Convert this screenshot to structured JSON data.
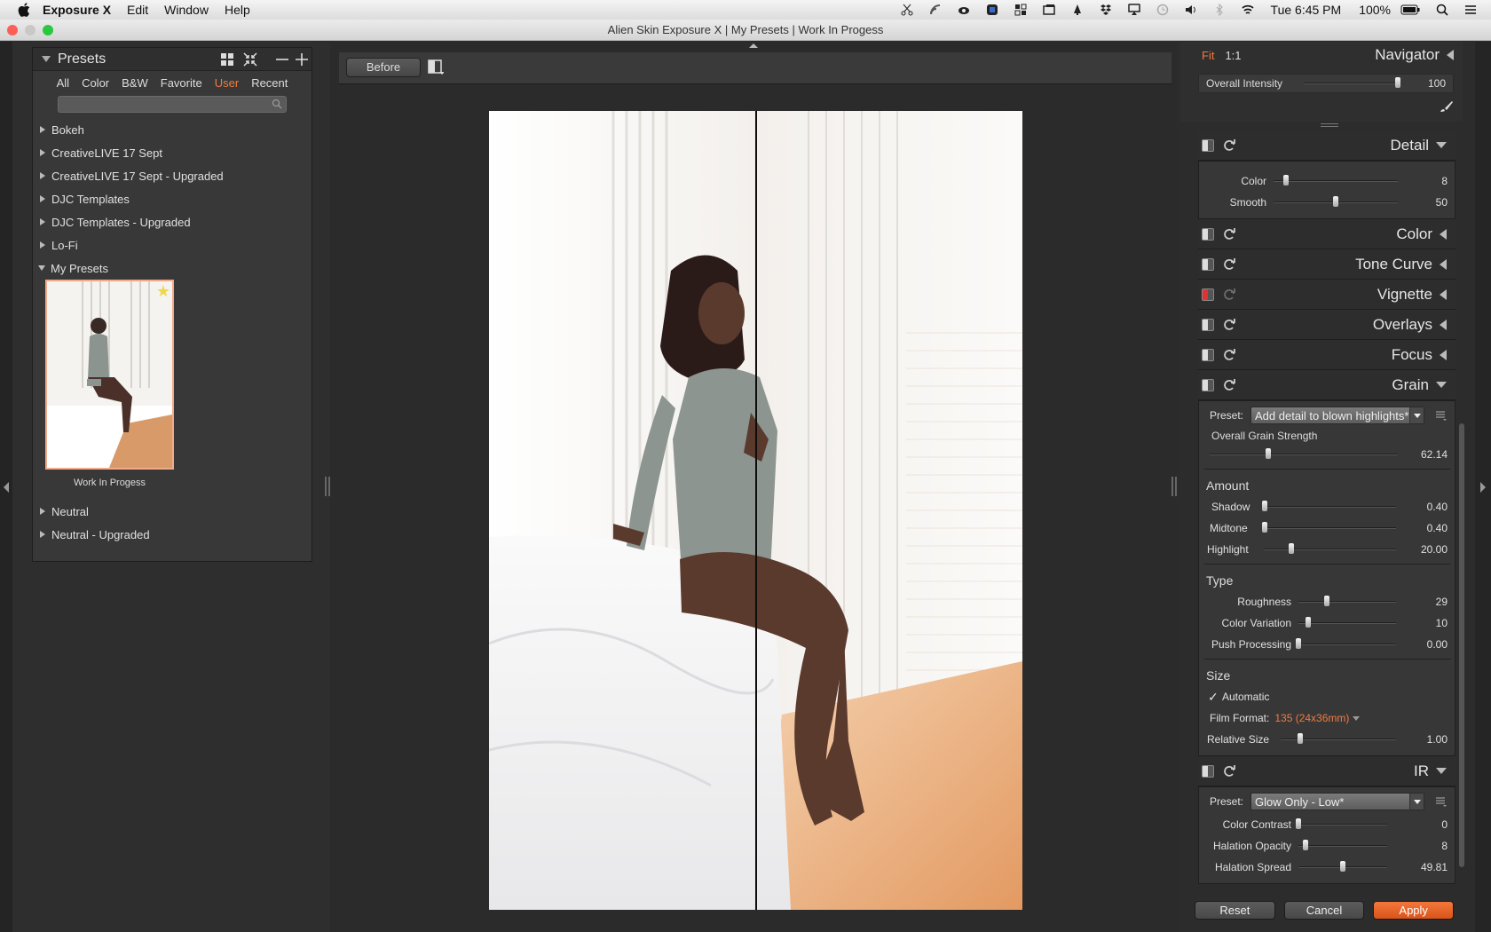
{
  "menubar": {
    "app_name": "Exposure X",
    "menus": [
      "Edit",
      "Window",
      "Help"
    ],
    "clock": "Tue 6:45 PM",
    "battery": "100%",
    "icons": [
      "scissors-icon",
      "feed-icon",
      "creative-cloud-icon",
      "badge-icon",
      "grid-icon",
      "stack-icon",
      "bell-icon",
      "dropbox-icon",
      "airplay-icon",
      "timemachine-icon",
      "volume-icon",
      "bluetooth-icon",
      "wifi-icon",
      "battery-icon",
      "search-icon",
      "list-icon"
    ]
  },
  "window": {
    "title": "Alien Skin Exposure X | My Presets | Work In Progess"
  },
  "presets": {
    "title": "Presets",
    "tabs": [
      {
        "label": "All",
        "active": false
      },
      {
        "label": "Color",
        "active": false
      },
      {
        "label": "B&W",
        "active": false
      },
      {
        "label": "Favorite",
        "active": false
      },
      {
        "label": "User",
        "active": true
      },
      {
        "label": "Recent",
        "active": false
      }
    ],
    "search_placeholder": "",
    "groups_top": [
      "Bokeh",
      "CreativeLIVE 17 Sept",
      "CreativeLIVE 17 Sept - Upgraded",
      "DJC Templates",
      "DJC Templates - Upgraded",
      "Lo-Fi"
    ],
    "expanded_group": "My Presets",
    "thumbnail_caption": "Work In Progess",
    "groups_bottom": [
      "Neutral",
      "Neutral - Upgraded"
    ]
  },
  "toolbar": {
    "before_label": "Before"
  },
  "navigator": {
    "fit_label": "Fit",
    "one_to_one_label": "1:1",
    "title": "Navigator",
    "intensity_label": "Overall Intensity",
    "intensity_value": "100",
    "intensity_level": 1.0
  },
  "panels": {
    "detail": {
      "title": "Detail",
      "sliders": [
        {
          "label": "Color",
          "value": "8",
          "level": 0.1
        },
        {
          "label": "Smooth",
          "value": "50",
          "level": 0.5
        }
      ]
    },
    "collapsed": [
      "Color",
      "Tone Curve",
      "Vignette",
      "Overlays",
      "Focus"
    ],
    "grain": {
      "title": "Grain",
      "preset_label": "Preset:",
      "preset_value": "Add detail to blown highlights*",
      "overall_label": "Overall Grain Strength",
      "overall_value": "62.14",
      "overall_level": 0.31,
      "amount_title": "Amount",
      "amount": [
        {
          "label": "Shadow",
          "value": "0.40",
          "level": 0.0
        },
        {
          "label": "Midtone",
          "value": "0.40",
          "level": 0.0
        },
        {
          "label": "Highlight",
          "value": "20.00",
          "level": 0.2
        }
      ],
      "type_title": "Type",
      "type": [
        {
          "label": "Roughness",
          "value": "29",
          "level": 0.29
        },
        {
          "label": "Color Variation",
          "value": "10",
          "level": 0.1
        },
        {
          "label": "Push Processing",
          "value": "0.00",
          "level": 0.0
        }
      ],
      "size_title": "Size",
      "automatic_label": "Automatic",
      "film_format_label": "Film Format:",
      "film_format_value": "135 (24x36mm)",
      "relative_size_label": "Relative Size",
      "relative_size_value": "1.00",
      "relative_size_level": 0.17
    },
    "ir": {
      "title": "IR",
      "preset_label": "Preset:",
      "preset_value": "Glow Only - Low*",
      "sliders": [
        {
          "label": "Color Contrast",
          "value": "0",
          "level": 0.0
        },
        {
          "label": "Halation Opacity",
          "value": "8",
          "level": 0.08
        },
        {
          "label": "Halation Spread",
          "value": "49.81",
          "level": 0.5
        }
      ]
    }
  },
  "buttons": {
    "reset": "Reset",
    "cancel": "Cancel",
    "apply": "Apply"
  },
  "colors": {
    "accent": "#f27a3e",
    "panel_bg": "#2c2c2c",
    "apply_button": "#e8652a"
  }
}
